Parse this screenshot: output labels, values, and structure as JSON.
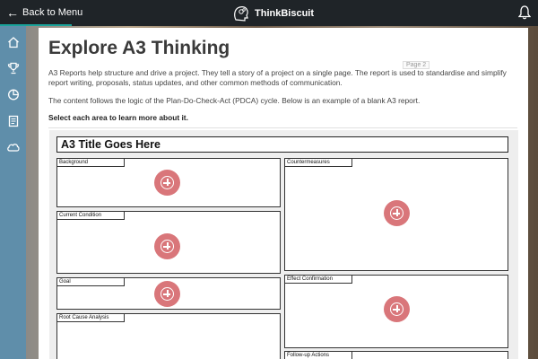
{
  "topbar": {
    "back_label": "Back to Menu",
    "brand_name": "ThinkBiscuit",
    "accent_color": "#1aa39a"
  },
  "sidebar": {
    "items": [
      {
        "icon": "home-icon"
      },
      {
        "icon": "trophy-icon"
      },
      {
        "icon": "pie-chart-icon"
      },
      {
        "icon": "document-icon"
      },
      {
        "icon": "cloud-icon"
      }
    ],
    "color": "#5f8eaa"
  },
  "main": {
    "title": "Explore A3 Thinking",
    "page_tag": "Page 2",
    "paragraph1": "A3 Reports help structure and drive a project. They tell a story of a project on a single page. The report is used to standardise and simplify report writing, proposals, status updates, and other common methods of communication.",
    "paragraph2": "The content follows the logic of the Plan-Do-Check-Act (PDCA) cycle. Below is an example of a blank A3 report.",
    "instruction": "Select each area to learn more about it."
  },
  "a3": {
    "title": "A3 Title Goes Here",
    "hotspot_color": "#d9767a",
    "sections": {
      "background": "Background",
      "current_condition": "Current Condition",
      "goal": "Goal",
      "root_cause": "Root Cause Analysis",
      "countermeasures": "Countermeasures",
      "effect_confirmation": "Effect Confirmation",
      "follow_up": "Follow-up Actions"
    }
  }
}
